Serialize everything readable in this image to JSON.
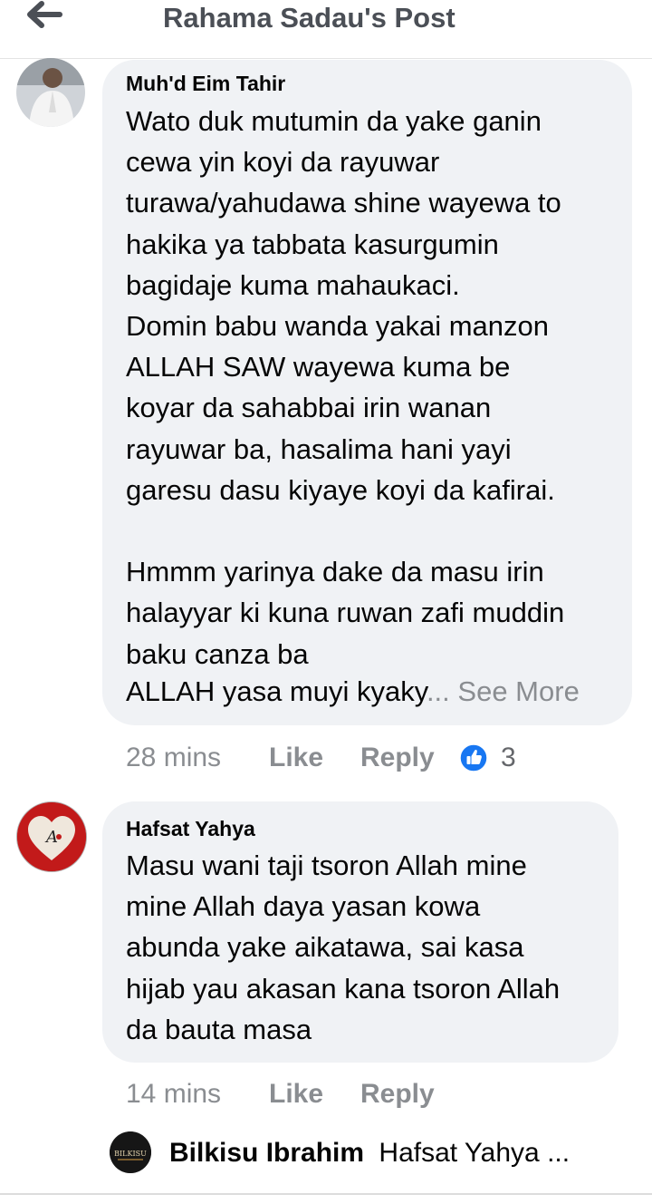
{
  "header": {
    "title": "Rahama Sadau's Post",
    "back_icon": "arrow-left-icon"
  },
  "comments": [
    {
      "author": "Muh'd Eim Tahir",
      "text": "Wato duk mutumin da yake ganin\ncewa yin koyi da rayuwar\nturawa/yahudawa shine wayewa to\nhakika ya tabbata kasurgumin\nbagidaje kuma mahaukaci.\nDomin babu wanda yakai manzon\nALLAH SAW wayewa kuma be\nkoyar da sahabbai irin wanan\nrayuwar ba, hasalima hani yayi\ngaresu dasu kiyaye koyi da kafirai.\n\nHmmm yarinya dake da masu irin\nhalayyar ki kuna ruwan zafi muddin\nbaku canza ba",
      "last_line": "ALLAH yasa muyi kyaky",
      "ellipsis": "...",
      "see_more": "See More",
      "time": "28 mins",
      "like_label": "Like",
      "reply_label": "Reply",
      "reaction_count": "3",
      "reaction_color": "#1877f2"
    },
    {
      "author": "Hafsat Yahya",
      "text": "Masu wani taji tsoron Allah mine\nmine Allah daya yasan kowa\nabunda yake aikatawa, sai kasa\nhijab yau akasan kana tsoron Allah\nda bauta masa",
      "time": "14 mins",
      "like_label": "Like",
      "reply_label": "Reply",
      "avatar_text": "A"
    }
  ],
  "reply_preview": {
    "author": "Bilkisu Ibrahim",
    "snippet": "Hafsat Yahya ...",
    "avatar_text": "BILKISU"
  }
}
